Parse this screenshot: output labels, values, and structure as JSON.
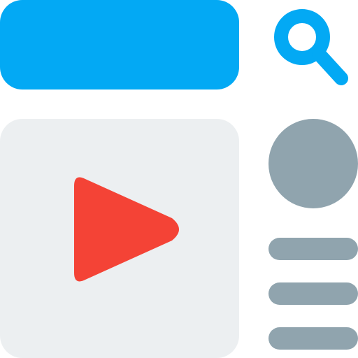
{
  "colors": {
    "accent": "#03A9F4",
    "panel_background": "#ECEFF1",
    "play_red": "#F44336",
    "neutral_gray": "#90A4AE"
  },
  "search": {
    "bar_icon": "search-bar-placeholder",
    "icon": "search-icon"
  },
  "video": {
    "icon": "play-icon"
  },
  "sidebar": {
    "avatar_icon": "avatar-placeholder",
    "text_lines": 3
  }
}
